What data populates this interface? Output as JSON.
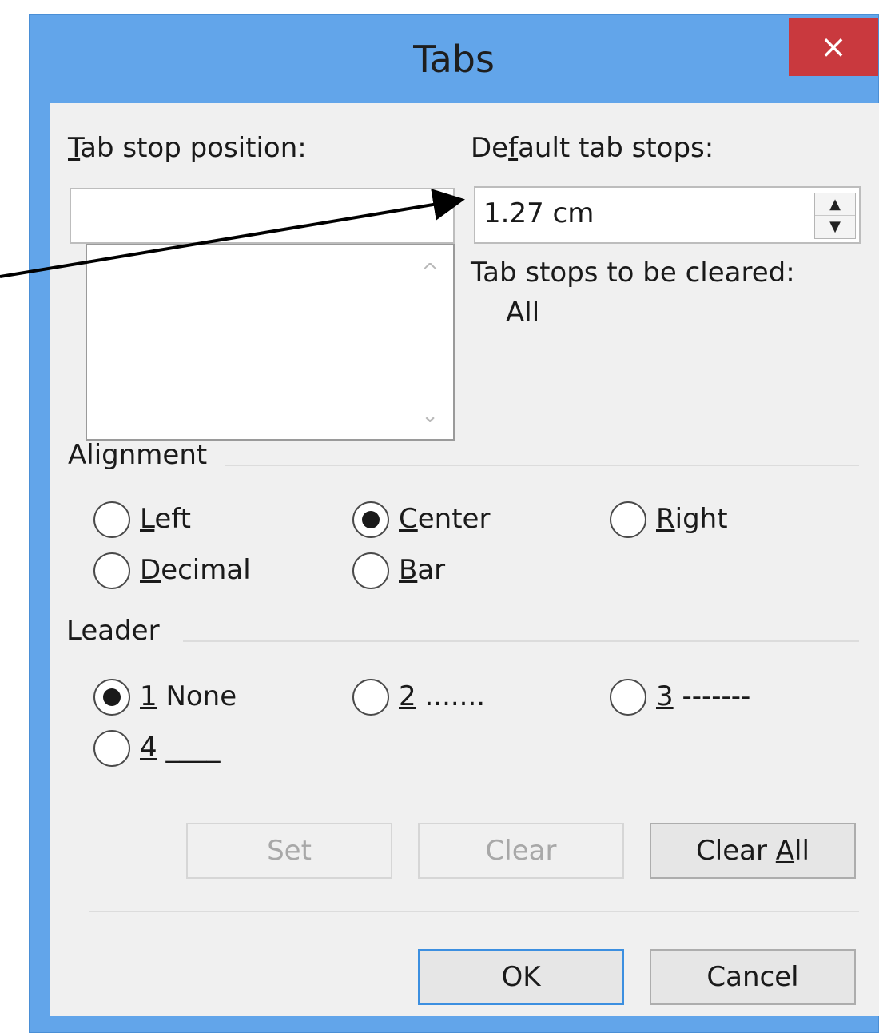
{
  "dialog": {
    "title": "Tabs",
    "close_label": "×"
  },
  "tab_stop_position": {
    "label_prefix": "T",
    "label_rest": "ab stop position:",
    "value": ""
  },
  "default_tab_stops": {
    "label_pre": "De",
    "label_u": "f",
    "label_post": "ault tab stops:",
    "value": "1.27 cm"
  },
  "tab_stops_to_be_cleared": {
    "label": "Tab stops to be cleared:",
    "value": "All"
  },
  "alignment": {
    "heading": "Alignment",
    "options": [
      {
        "u": "L",
        "rest": "eft",
        "checked": false
      },
      {
        "u": "C",
        "rest": "enter",
        "checked": true
      },
      {
        "u": "R",
        "rest": "ight",
        "checked": false
      },
      {
        "u": "D",
        "rest": "ecimal",
        "checked": false
      },
      {
        "u": "B",
        "rest": "ar",
        "checked": false
      }
    ]
  },
  "leader": {
    "heading": "Leader",
    "options": [
      {
        "u": "1",
        "rest": " None",
        "checked": true
      },
      {
        "u": "2",
        "rest": " .......",
        "checked": false
      },
      {
        "u": "3",
        "rest": " -------",
        "checked": false
      },
      {
        "u": "4",
        "rest": " ____",
        "checked": false
      }
    ]
  },
  "buttons": {
    "set": "Set",
    "clear": "Clear",
    "clear_all_pre": "Clear ",
    "clear_all_u": "A",
    "clear_all_post": "ll",
    "ok": "OK",
    "cancel": "Cancel"
  },
  "colors": {
    "titlebar": "#62a5ea",
    "close": "#c9393e",
    "client": "#f0f0f0"
  }
}
